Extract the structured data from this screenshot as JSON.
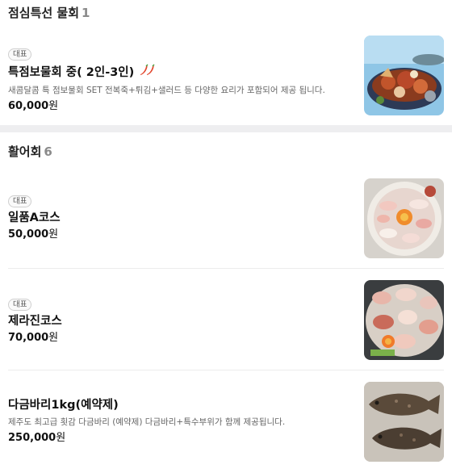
{
  "sections": [
    {
      "title": "점심특선 물회",
      "count": "1",
      "items": [
        {
          "badge": "대표",
          "name": "특점보물회 중( 2인-3인)",
          "spicy": true,
          "description": "새콤달콤 특 점보물회 SET 전복죽+튀김+샐러드 등 다양한 요리가 포함되어 제공 됩니다.",
          "price": "60,000",
          "currency": "원",
          "image": "spicy-seafood-platter"
        }
      ]
    },
    {
      "title": "활어회",
      "count": "6",
      "items": [
        {
          "badge": "대표",
          "name": "일품A코스",
          "price": "50,000",
          "currency": "원",
          "image": "sashimi-round-plate"
        },
        {
          "badge": "대표",
          "name": "제라진코스",
          "price": "70,000",
          "currency": "원",
          "image": "sashimi-course-plate"
        },
        {
          "name": "다금바리1kg(예약제)",
          "description": "제주도 최고급 횟감 다금바리 (예약제) 다금바리+특수부위가 함께 제공됩니다.",
          "price": "250,000",
          "currency": "원",
          "image": "whole-grouper-fish"
        }
      ]
    }
  ],
  "colors": {
    "chili_red": "#e2452c",
    "divider": "#eeeef0",
    "count_gray": "#8a8a8a"
  }
}
